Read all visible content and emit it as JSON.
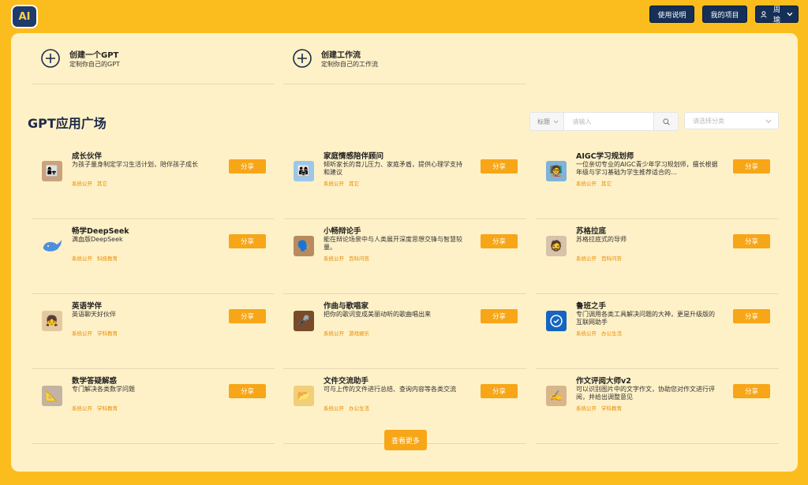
{
  "app": {
    "logo_text": "AI"
  },
  "topnav": {
    "help": "使用说明",
    "projects": "我的项目",
    "user": "周瑜"
  },
  "create": [
    {
      "title": "创建一个GPT",
      "desc": "定制你自己的GPT"
    },
    {
      "title": "创建工作流",
      "desc": "定制你自己的工作流"
    }
  ],
  "section": {
    "title": "GPT应用广场"
  },
  "search": {
    "field_label": "标题",
    "placeholder": "请输入",
    "category_placeholder": "请选择分类"
  },
  "share_label": "分享",
  "more_label": "查看更多",
  "cards": [
    {
      "title": "成长伙伴",
      "desc": "为孩子量身制定学习生活计划，陪伴孩子成长",
      "tag1": "系统公开",
      "tag2": "其它"
    },
    {
      "title": "家庭情感陪伴顾问",
      "desc": "倾听家长的育儿压力、家庭矛盾，提供心理学支持和建议",
      "tag1": "系统公开",
      "tag2": "其它"
    },
    {
      "title": "AIGC学习规划师",
      "desc": "一位亲切专业的AIGC青少年学习规划师，擅长根据年级与学习基础为学生推荐适合的…",
      "tag1": "系统公开",
      "tag2": "其它"
    },
    {
      "title": "畅学DeepSeek",
      "desc": "满血版DeepSeek",
      "tag1": "系统公开",
      "tag2": "科技教育"
    },
    {
      "title": "小畅辩论手",
      "desc": "能在辩论场景中与人类展开深度思想交锋与智慧较量。",
      "tag1": "系统公开",
      "tag2": "百科问答"
    },
    {
      "title": "苏格拉底",
      "desc": "苏格拉底式的导师",
      "tag1": "系统公开",
      "tag2": "百科问答"
    },
    {
      "title": "英语学伴",
      "desc": "英语聊天好伙伴",
      "tag1": "系统公开",
      "tag2": "学科教育"
    },
    {
      "title": "作曲与歌唱家",
      "desc": "把你的歌词变成美丽动听的歌曲唱出来",
      "tag1": "系统公开",
      "tag2": "游戏娱乐"
    },
    {
      "title": "鲁班之手",
      "desc": "专门调用各类工具解决问题的大神，更是升级版的互联网助手",
      "tag1": "系统公开",
      "tag2": "办公生活"
    },
    {
      "title": "数学答疑解惑",
      "desc": "专门解决各类数学问题",
      "tag1": "系统公开",
      "tag2": "学科教育"
    },
    {
      "title": "文件交流助手",
      "desc": "可与上传的文件进行总结、查询内容等各类交流",
      "tag1": "系统公开",
      "tag2": "办公生活"
    },
    {
      "title": "作文评阅大师v2",
      "desc": "可以识别图片中的文字作文，协助您对作文进行评阅，并给出调整意见",
      "tag1": "系统公开",
      "tag2": "学科教育"
    }
  ]
}
